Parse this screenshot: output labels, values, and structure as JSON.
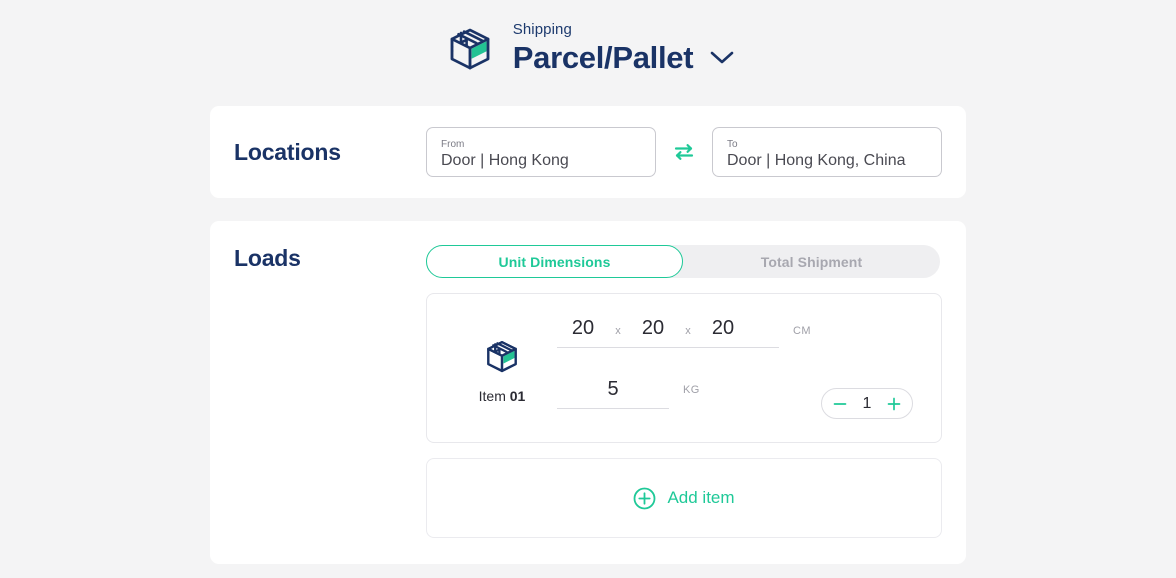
{
  "header": {
    "eyebrow": "Shipping",
    "title": "Parcel/Pallet",
    "box_icon": "box-icon",
    "chevron_icon": "chevron-down-icon"
  },
  "locations": {
    "section_title": "Locations",
    "from": {
      "label": "From",
      "value": "Door | Hong Kong",
      "placeholder": "From"
    },
    "to": {
      "label": "To",
      "value": "Door | Hong Kong, China",
      "placeholder": "To"
    },
    "swap_icon": "swap-arrows-icon"
  },
  "loads": {
    "section_title": "Loads",
    "tabs": [
      {
        "label": "Unit Dimensions",
        "active": true
      },
      {
        "label": "Total Shipment",
        "active": false
      }
    ],
    "item": {
      "icon": "box-icon",
      "label_prefix": "Item",
      "label_number": "01",
      "dimensions": {
        "length": "20",
        "width": "20",
        "height": "20",
        "separator": "x",
        "unit": "CM"
      },
      "weight": {
        "value": "5",
        "unit": "KG"
      },
      "quantity": {
        "value": "1",
        "decrement_icon": "minus-icon",
        "increment_icon": "plus-icon"
      }
    },
    "add_item": {
      "label": "Add item",
      "icon": "plus-circle-icon"
    }
  },
  "colors": {
    "navy": "#1a3366",
    "green": "#1fc998",
    "page_bg": "#f4f4f5",
    "card_bg": "#ffffff",
    "muted": "#a0a0a8"
  }
}
